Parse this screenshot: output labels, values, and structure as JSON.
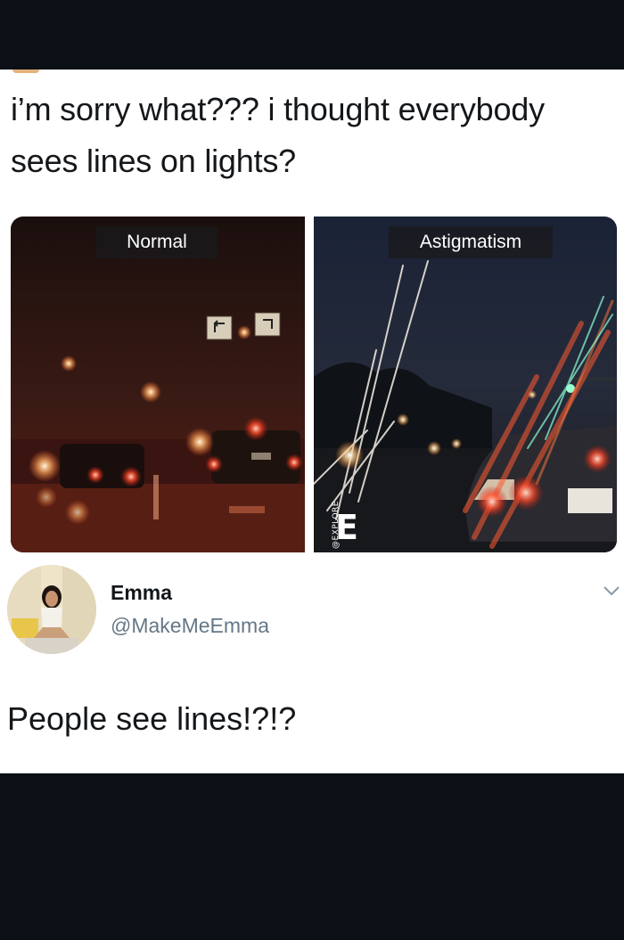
{
  "tweet": {
    "text": "i’m sorry what??? i thought everybody sees lines on lights?"
  },
  "images": {
    "left_label": "Normal",
    "right_label": "Astigmatism",
    "watermark_letter": "E",
    "watermark_text": "@EXPLORE"
  },
  "reply": {
    "name": "Emma",
    "handle": "@MakeMeEmma",
    "text": "People see lines!?!?"
  },
  "icons": {
    "caret": "chevron-down-icon",
    "avatar": "avatar"
  }
}
